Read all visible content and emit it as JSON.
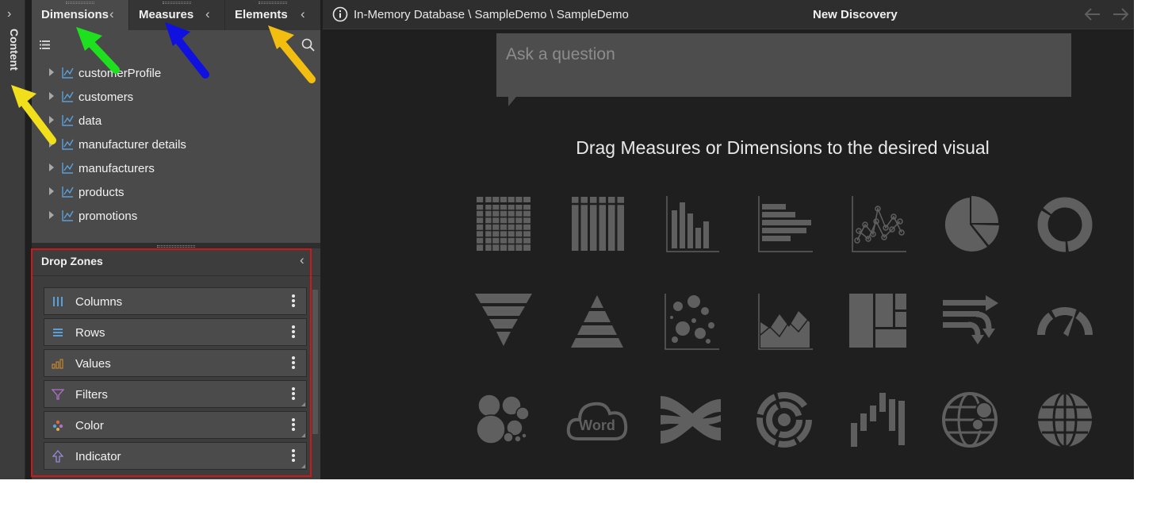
{
  "rail": {
    "label": "Content"
  },
  "tabs": [
    {
      "label": "Dimensions"
    },
    {
      "label": "Measures"
    },
    {
      "label": "Elements"
    }
  ],
  "tree": {
    "items": [
      {
        "label": "customerProfile"
      },
      {
        "label": "customers"
      },
      {
        "label": "data"
      },
      {
        "label": "manufacturer details"
      },
      {
        "label": "manufacturers"
      },
      {
        "label": "products"
      },
      {
        "label": "promotions"
      }
    ]
  },
  "drop_zones": {
    "title": "Drop Zones",
    "zones": [
      {
        "label": "Columns",
        "icon": "columns-icon",
        "color": "#5aa0d8"
      },
      {
        "label": "Rows",
        "icon": "rows-icon",
        "color": "#5aa0d8"
      },
      {
        "label": "Values",
        "icon": "values-icon",
        "color": "#d8902a"
      },
      {
        "label": "Filters",
        "icon": "filter-icon",
        "color": "#b070c8"
      },
      {
        "label": "Color",
        "icon": "color-icon",
        "color": "#d86a3a"
      },
      {
        "label": "Indicator",
        "icon": "indicator-icon",
        "color": "#9a8ad8"
      }
    ]
  },
  "header": {
    "breadcrumb": "In-Memory Database \\ SampleDemo \\ SampleDemo",
    "title": "New Discovery"
  },
  "ask": {
    "placeholder": "Ask a question"
  },
  "canvas": {
    "hint": "Drag Measures or Dimensions to the desired visual"
  },
  "visuals": [
    "grid-icon",
    "column-table-icon",
    "bar-chart-icon",
    "horizontal-bar-icon",
    "scatter-line-icon",
    "pie-chart-icon",
    "donut-chart-icon",
    "funnel-icon",
    "pyramid-icon",
    "bubble-scatter-icon",
    "area-chart-icon",
    "treemap-icon",
    "flow-icon",
    "gauge-icon",
    "packed-bubbles-icon",
    "word-cloud-icon",
    "sankey-icon",
    "sunburst-icon",
    "waterfall-icon",
    "bubble-map-icon",
    "globe-map-icon"
  ],
  "word_cloud_text": "Word",
  "colors": {
    "accent_red_box": "#d01818",
    "arrow_yellow": "#f2df1c",
    "arrow_green": "#1fe01f",
    "arrow_blue": "#1010e0",
    "arrow_orange": "#f2be10"
  }
}
